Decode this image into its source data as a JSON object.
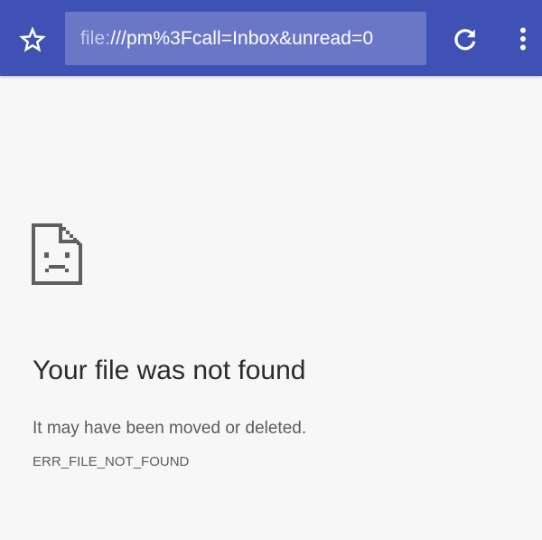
{
  "toolbar": {
    "background": "#3f51b5",
    "star_icon": "star-outline-icon",
    "url": {
      "scheme": "file:",
      "rest": "///pm%3Fcall=Inbox&unread=0"
    },
    "reload_icon": "reload-icon",
    "menu_icon": "more-vert-icon"
  },
  "error": {
    "icon": "sad-file-icon",
    "title": "Your file was not found",
    "description": "It may have been moved or deleted.",
    "code": "ERR_FILE_NOT_FOUND"
  }
}
